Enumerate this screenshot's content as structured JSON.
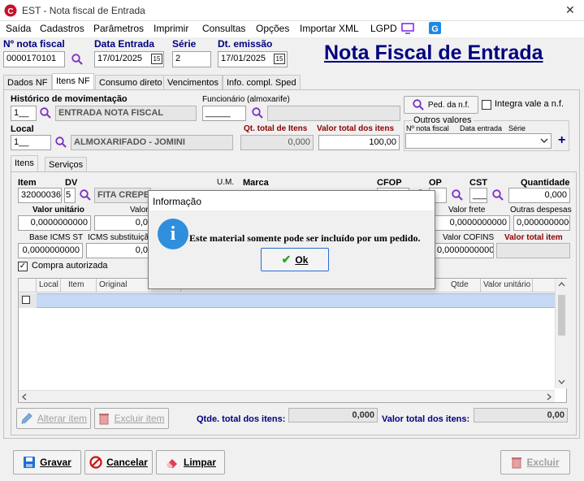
{
  "window": {
    "title": "EST - Nota fiscal de Entrada",
    "close_glyph": "✕"
  },
  "menu": [
    "Saída",
    "Cadastros",
    "Parâmetros",
    "Imprimir",
    "Consultas",
    "Opções",
    "Importar XML",
    "LGPD"
  ],
  "header": {
    "nf_label": "Nº nota fiscal",
    "nf_value": "0000170101",
    "entrada_label": "Data Entrada",
    "entrada_value": "17/01/2025",
    "serie_label": "Série",
    "serie_value": "2",
    "emissao_label": "Dt. emissão",
    "emissao_value": "17/01/2025",
    "calendar_glyph": "15",
    "page_title": "Nota Fiscal de Entrada"
  },
  "main_tabs": [
    "Dados NF",
    "Itens NF",
    "Consumo direto",
    "Vencimentos",
    "Info. compl. Sped"
  ],
  "itens_nf": {
    "historico_label": "Histórico de movimentação",
    "historico_code": "1__",
    "historico_desc": "ENTRADA NOTA FISCAL",
    "funcionario_label": "Funcionário (almoxarife)",
    "funcionario_code": "_____",
    "ped_button": "Ped. da n.f.",
    "integra_label": "Integra vale a n.f.",
    "local_label": "Local",
    "local_code": "1__",
    "local_desc": "ALMOXARIFADO - JOMINI",
    "qt_total_label": "Qt. total de Itens",
    "qt_total_value": "0,000",
    "valor_total_label": "Valor total dos itens",
    "valor_total_value": "100,00",
    "outros_title": "Outros valores",
    "outros_cols": [
      "Nº nota fiscal",
      "Data entrada",
      "Série"
    ],
    "add_glyph": "+"
  },
  "sub_tabs": [
    "Itens",
    "Serviços"
  ],
  "item_form": {
    "item_label": "Item",
    "item_value": "32000036",
    "dv_label": "DV",
    "dv_value": "5",
    "desc_value": "FITA CREPE",
    "um_label": "U.M.",
    "marca_label": "Marca",
    "cfop_label": "CFOP",
    "op_label": "OP",
    "cst_label": "CST",
    "cst_value": "___",
    "quantidade_label": "Quantidade",
    "quantidade_value": "0,000",
    "valor_unit_label": "Valor unitário",
    "valor_unit_value": "0,0000000000",
    "valor2_label": "Valor",
    "valor2_value": "0,0",
    "frete_label": "Valor frete",
    "frete_value": "0,0000000000",
    "despesas_label": "Outras despesas",
    "despesas_value": "0,0000000000",
    "base_st_label": "Base ICMS ST",
    "base_st_value": "0,0000000000",
    "icms_sub_label": "ICMS substituição",
    "icms_sub_value": "0,0",
    "cofins_label": "Valor COFINS",
    "cofins_value": "0,0000000000",
    "total_item_label": "Valor total item",
    "compra_label": "Compra autorizada"
  },
  "grid": {
    "columns": [
      "Local",
      "Item",
      "Original",
      "Qtde",
      "Valor unitário"
    ]
  },
  "bottom": {
    "alterar": "Alterar item",
    "excluir_item": "Excluir item",
    "qtde_label": "Qtde. total dos itens:",
    "qtde_value": "0,000",
    "valor_label": "Valor total dos itens:",
    "valor_value": "0,00"
  },
  "footer": {
    "gravar": "Gravar",
    "cancelar": "Cancelar",
    "limpar": "Limpar",
    "excluir": "Excluir"
  },
  "dialog": {
    "title": "Informação",
    "message": "Este material somente pode ser incluído por um pedido.",
    "ok": "Ok",
    "info_glyph": "i",
    "check_glyph": "✔"
  },
  "colors": {
    "accent_navy": "#000080",
    "label_red": "#8b0000",
    "selection": "#0078d7",
    "info_blue": "#2f8fdd"
  }
}
